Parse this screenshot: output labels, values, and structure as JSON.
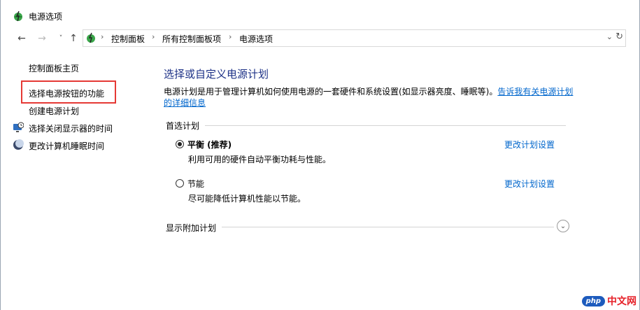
{
  "window": {
    "title": "电源选项"
  },
  "addressbar": {
    "crumbs": [
      "控制面板",
      "所有控制面板项",
      "电源选项"
    ]
  },
  "sidebar": {
    "home": "控制面板主页",
    "items": [
      {
        "label": "选择电源按钮的功能"
      },
      {
        "label": "创建电源计划"
      },
      {
        "label": "选择关闭显示器的时间",
        "icon": "monitor-clock-icon"
      },
      {
        "label": "更改计算机睡眠时间",
        "icon": "moon-icon"
      }
    ]
  },
  "main": {
    "heading": "选择或自定义电源计划",
    "description": "电源计划是用于管理计算机如何使用电源的一套硬件和系统设置(如显示器亮度、睡眠等)。",
    "description_link": "告诉我有关电源计划的详细信息",
    "preferred_label": "首选计划",
    "plans": [
      {
        "name": "平衡 (推荐)",
        "desc": "利用可用的硬件自动平衡功耗与性能。",
        "selected": true,
        "link": "更改计划设置"
      },
      {
        "name": "节能",
        "desc": "尽可能降低计算机性能以节能。",
        "selected": false,
        "link": "更改计划设置"
      }
    ],
    "additional_label": "显示附加计划"
  },
  "watermark": {
    "badge": "php",
    "text": "中文网"
  },
  "colors": {
    "link": "#0066cc",
    "heading": "#1e3287",
    "highlight": "#e53935"
  }
}
